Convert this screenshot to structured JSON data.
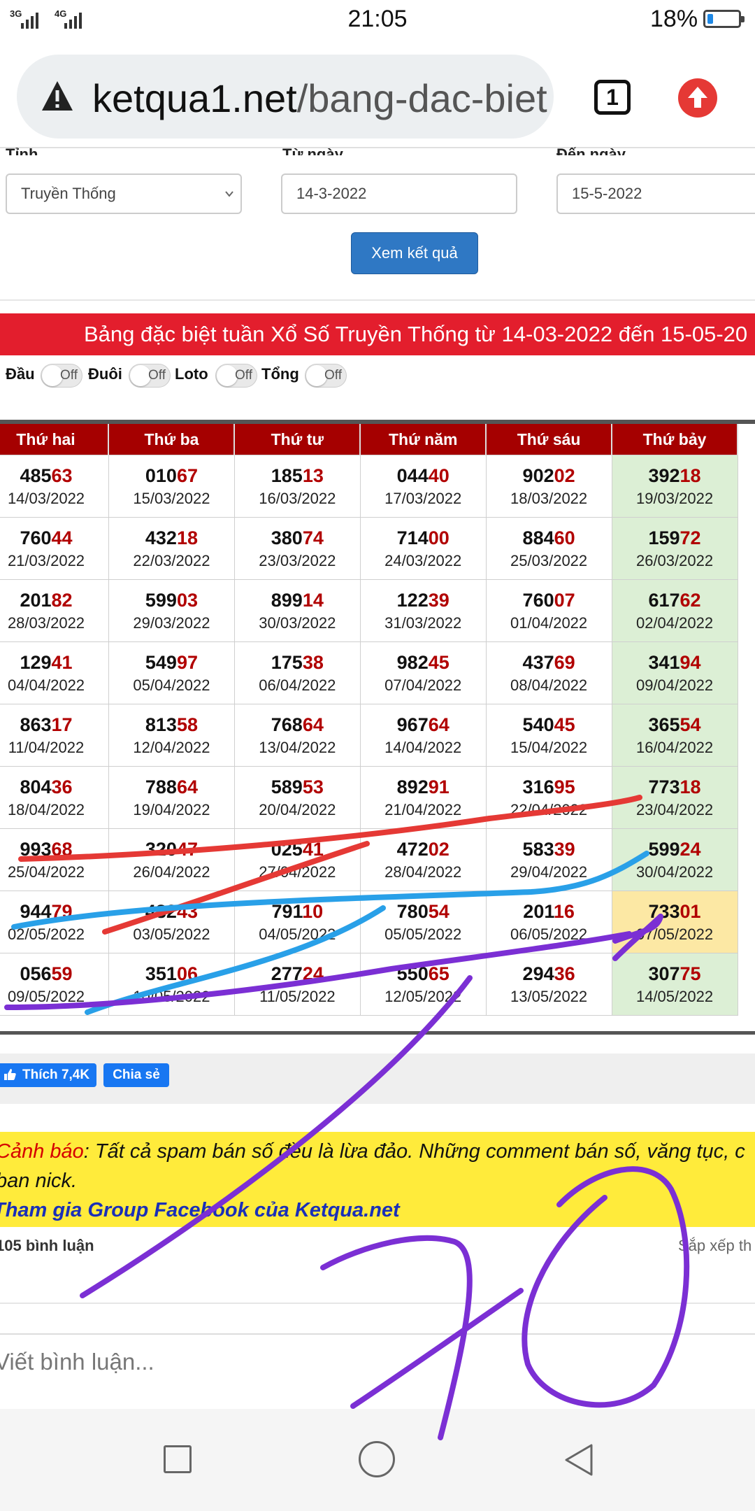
{
  "status_bar": {
    "signal1": "3G",
    "signal2": "4G",
    "time": "21:05",
    "battery": "18%",
    "battery_level": 0.18
  },
  "browser": {
    "url_domain": "ketqua1.net",
    "url_path": "/bang-dac-biet",
    "tab_count": "1"
  },
  "form": {
    "province_label": "Tỉnh",
    "province_value": "Truyền Thống",
    "from_label": "Từ ngày",
    "from_value": "14-3-2022",
    "to_label": "Đến ngày",
    "to_value": "15-5-2022",
    "submit_label": "Xem kết quả"
  },
  "banner": "Bảng đặc biệt tuần Xổ Số Truyền Thống từ 14-03-2022 đến 15-05-20",
  "toggles": [
    {
      "label": "Đầu",
      "state": "Off"
    },
    {
      "label": "Đuôi",
      "state": "Off"
    },
    {
      "label": "Loto",
      "state": "Off"
    },
    {
      "label": "Tổng",
      "state": "Off"
    }
  ],
  "table": {
    "headers": [
      "Thứ hai",
      "Thứ ba",
      "Thứ tư",
      "Thứ năm",
      "Thứ sáu",
      "Thứ bảy"
    ],
    "rows": [
      [
        {
          "h": "485",
          "t": "63",
          "d": "14/03/2022"
        },
        {
          "h": "010",
          "t": "67",
          "d": "15/03/2022"
        },
        {
          "h": "185",
          "t": "13",
          "d": "16/03/2022"
        },
        {
          "h": "044",
          "t": "40",
          "d": "17/03/2022"
        },
        {
          "h": "902",
          "t": "02",
          "d": "18/03/2022"
        },
        {
          "h": "392",
          "t": "18",
          "d": "19/03/2022"
        }
      ],
      [
        {
          "h": "760",
          "t": "44",
          "d": "21/03/2022"
        },
        {
          "h": "432",
          "t": "18",
          "d": "22/03/2022"
        },
        {
          "h": "380",
          "t": "74",
          "d": "23/03/2022"
        },
        {
          "h": "714",
          "t": "00",
          "d": "24/03/2022"
        },
        {
          "h": "884",
          "t": "60",
          "d": "25/03/2022"
        },
        {
          "h": "159",
          "t": "72",
          "d": "26/03/2022"
        }
      ],
      [
        {
          "h": "201",
          "t": "82",
          "d": "28/03/2022"
        },
        {
          "h": "599",
          "t": "03",
          "d": "29/03/2022"
        },
        {
          "h": "899",
          "t": "14",
          "d": "30/03/2022"
        },
        {
          "h": "122",
          "t": "39",
          "d": "31/03/2022"
        },
        {
          "h": "760",
          "t": "07",
          "d": "01/04/2022"
        },
        {
          "h": "617",
          "t": "62",
          "d": "02/04/2022"
        }
      ],
      [
        {
          "h": "129",
          "t": "41",
          "d": "04/04/2022"
        },
        {
          "h": "549",
          "t": "97",
          "d": "05/04/2022"
        },
        {
          "h": "175",
          "t": "38",
          "d": "06/04/2022"
        },
        {
          "h": "982",
          "t": "45",
          "d": "07/04/2022"
        },
        {
          "h": "437",
          "t": "69",
          "d": "08/04/2022"
        },
        {
          "h": "341",
          "t": "94",
          "d": "09/04/2022"
        }
      ],
      [
        {
          "h": "863",
          "t": "17",
          "d": "11/04/2022"
        },
        {
          "h": "813",
          "t": "58",
          "d": "12/04/2022"
        },
        {
          "h": "768",
          "t": "64",
          "d": "13/04/2022"
        },
        {
          "h": "967",
          "t": "64",
          "d": "14/04/2022"
        },
        {
          "h": "540",
          "t": "45",
          "d": "15/04/2022"
        },
        {
          "h": "365",
          "t": "54",
          "d": "16/04/2022"
        }
      ],
      [
        {
          "h": "804",
          "t": "36",
          "d": "18/04/2022"
        },
        {
          "h": "788",
          "t": "64",
          "d": "19/04/2022"
        },
        {
          "h": "589",
          "t": "53",
          "d": "20/04/2022"
        },
        {
          "h": "892",
          "t": "91",
          "d": "21/04/2022"
        },
        {
          "h": "316",
          "t": "95",
          "d": "22/04/2022"
        },
        {
          "h": "773",
          "t": "18",
          "d": "23/04/2022"
        }
      ],
      [
        {
          "h": "993",
          "t": "68",
          "d": "25/04/2022"
        },
        {
          "h": "320",
          "t": "47",
          "d": "26/04/2022"
        },
        {
          "h": "025",
          "t": "41",
          "d": "27/04/2022"
        },
        {
          "h": "472",
          "t": "02",
          "d": "28/04/2022"
        },
        {
          "h": "583",
          "t": "39",
          "d": "29/04/2022"
        },
        {
          "h": "599",
          "t": "24",
          "d": "30/04/2022"
        }
      ],
      [
        {
          "h": "944",
          "t": "79",
          "d": "02/05/2022"
        },
        {
          "h": "482",
          "t": "43",
          "d": "03/05/2022"
        },
        {
          "h": "791",
          "t": "10",
          "d": "04/05/2022"
        },
        {
          "h": "780",
          "t": "54",
          "d": "05/05/2022"
        },
        {
          "h": "201",
          "t": "16",
          "d": "06/05/2022"
        },
        {
          "h": "733",
          "t": "01",
          "d": "07/05/2022",
          "hl": true
        }
      ],
      [
        {
          "h": "056",
          "t": "59",
          "d": "09/05/2022"
        },
        {
          "h": "351",
          "t": "06",
          "d": "10/05/2022"
        },
        {
          "h": "277",
          "t": "24",
          "d": "11/05/2022"
        },
        {
          "h": "550",
          "t": "65",
          "d": "12/05/2022"
        },
        {
          "h": "294",
          "t": "36",
          "d": "13/05/2022"
        },
        {
          "h": "307",
          "t": "75",
          "d": "14/05/2022"
        }
      ]
    ]
  },
  "social": {
    "like_label": "Thích 7,4K",
    "share_label": "Chia sẻ"
  },
  "warning": {
    "prefix": "Cảnh báo",
    "line1_rest": ": Tất cả spam bán số đều là lừa đảo. Những comment bán số, văng tục, c",
    "line2": "ban nick.",
    "line3": "Tham gia Group Facebook của Ketqua.net"
  },
  "comments": {
    "count": "105 bình luận",
    "sort": "Sắp xếp th",
    "placeholder": "Viết bình luận..."
  },
  "colors": {
    "banner": "#e31e2d",
    "header": "#a50000",
    "saturday": "#dcefd5",
    "highlight": "#fce8a4",
    "warning_bg": "#ffeb3b"
  }
}
